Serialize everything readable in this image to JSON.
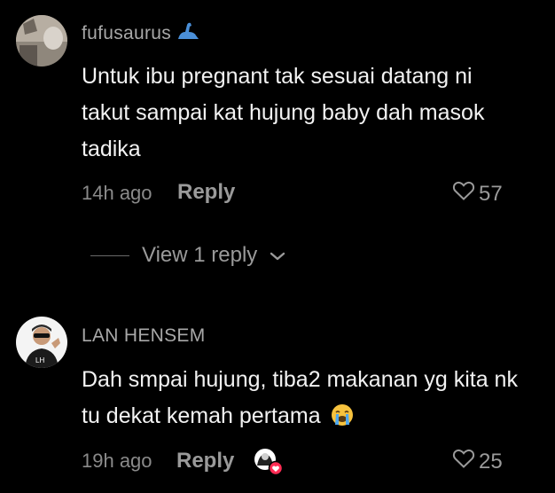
{
  "comments": [
    {
      "username": "fufusaurus",
      "username_badge": "dinosaur-emoji",
      "text": "Untuk ibu pregnant tak sesuai datang ni takut sampai kat hujung baby dah masok tadika",
      "time": "14h ago",
      "reply_label": "Reply",
      "likes": "57"
    },
    {
      "username": "LAN HENSEM",
      "text": "Dah smpai hujung, tiba2 makanan yg kita nk tu dekat kemah pertama",
      "text_emoji": "loudly-crying-face-emoji",
      "time": "19h ago",
      "reply_label": "Reply",
      "creator_liked_badge": "creator-liked-heart",
      "likes": "25"
    }
  ],
  "view_replies": {
    "label": "View 1 reply"
  },
  "colors": {
    "background": "#000000",
    "text": "#f2f2f2",
    "muted": "#9a9a9a",
    "username": "#a8a8a8",
    "heart_badge": "#ff2d55"
  }
}
